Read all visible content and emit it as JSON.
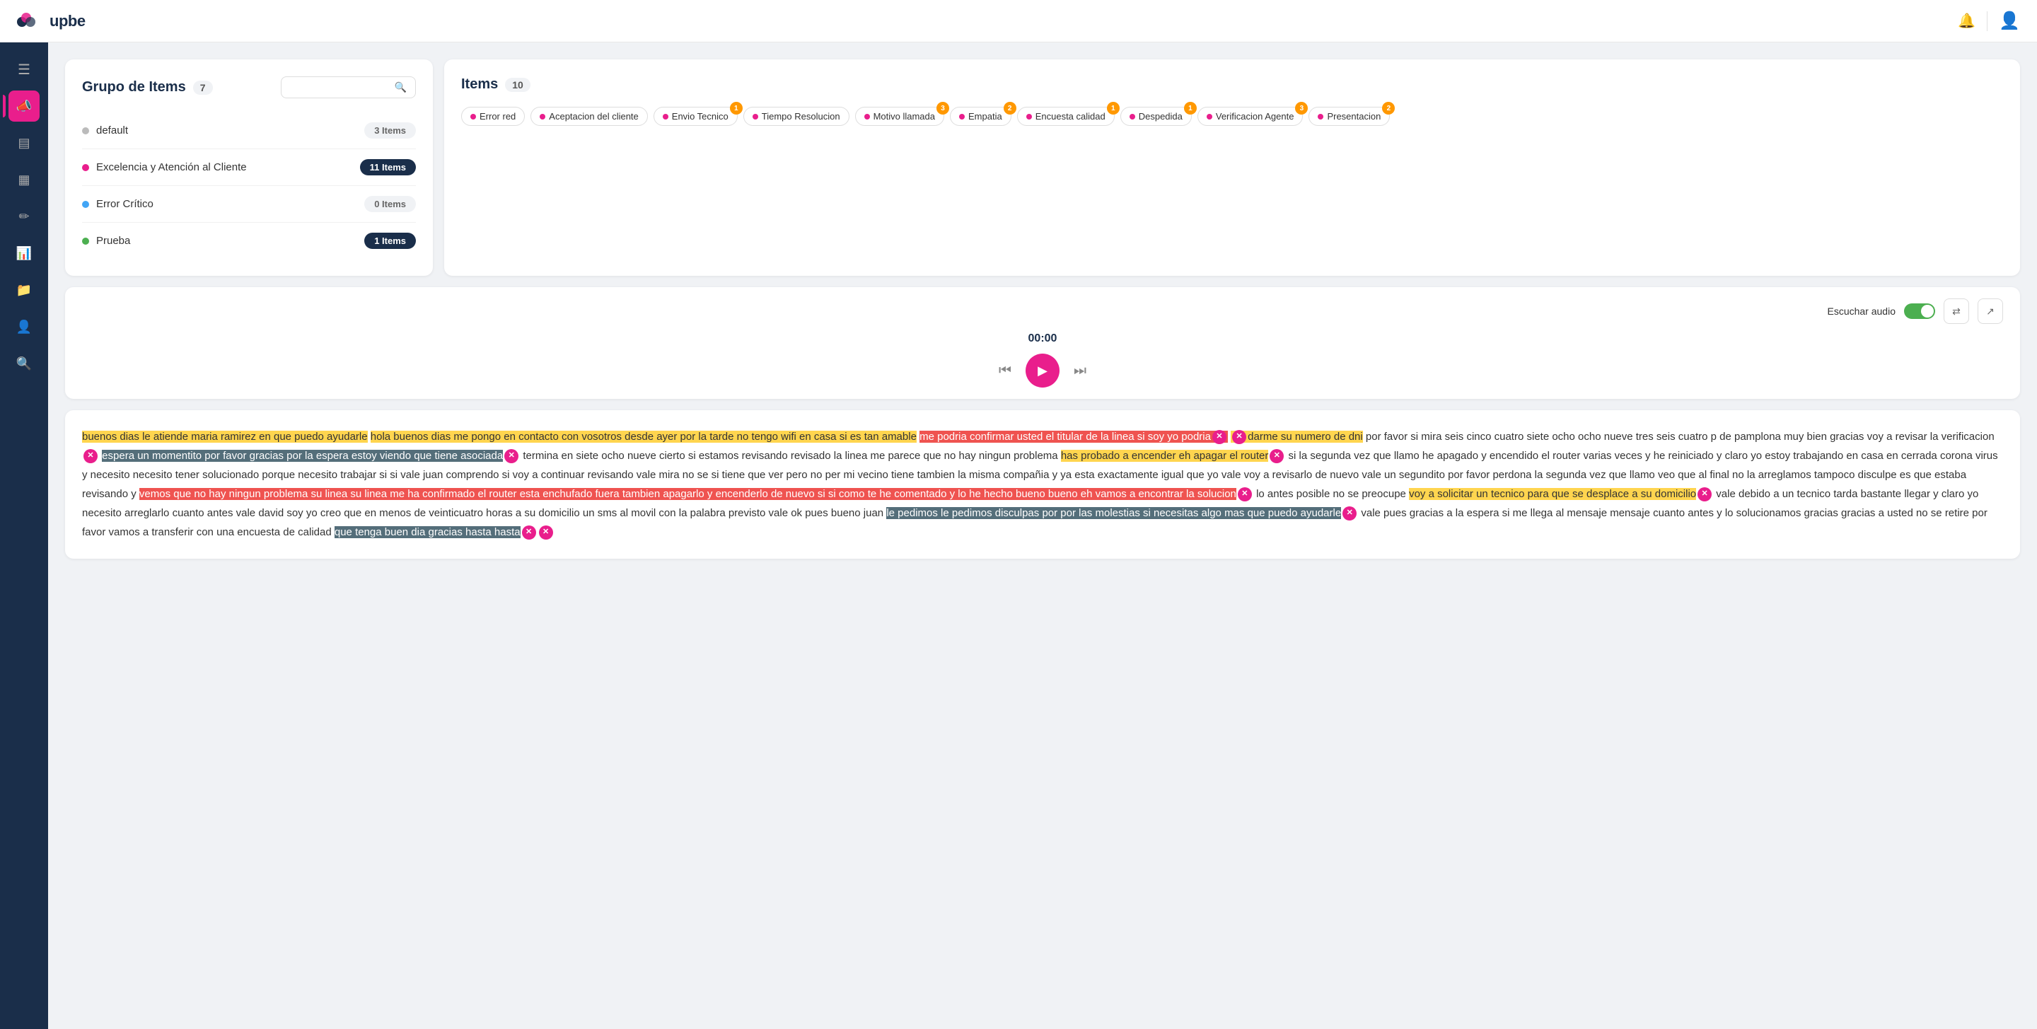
{
  "navbar": {
    "logo_text": "upbe",
    "notification_icon": "🔔",
    "user_icon": "👤"
  },
  "sidebar": {
    "items": [
      {
        "id": "menu",
        "icon": "☰",
        "active": false
      },
      {
        "id": "megaphone",
        "icon": "📣",
        "active": true
      },
      {
        "id": "list",
        "icon": "☰",
        "active": false
      },
      {
        "id": "grid",
        "icon": "▦",
        "active": false
      },
      {
        "id": "pencil",
        "icon": "✏",
        "active": false
      },
      {
        "id": "chart",
        "icon": "📊",
        "active": false
      },
      {
        "id": "folder",
        "icon": "📁",
        "active": false
      },
      {
        "id": "user",
        "icon": "👤",
        "active": false
      },
      {
        "id": "search",
        "icon": "🔍",
        "active": false
      }
    ]
  },
  "left_panel": {
    "title": "Grupo de Items",
    "count": 7,
    "search_placeholder": "",
    "items": [
      {
        "name": "default",
        "dot_color": "#bbb",
        "badge": "3 Items",
        "dark": false
      },
      {
        "name": "Excelencia y Atención al Cliente",
        "dot_color": "#e91e8c",
        "badge": "11 Items",
        "dark": true
      },
      {
        "name": "Error Crítico",
        "dot_color": "#42a5f5",
        "badge": "0 Items",
        "dark": false
      },
      {
        "name": "Prueba",
        "dot_color": "#4caf50",
        "badge": "1 Items",
        "dark": true
      }
    ]
  },
  "right_panel": {
    "title": "Items",
    "count": 10,
    "tags": [
      {
        "label": "Error red",
        "dot_color": "#e91e8c",
        "badge": null
      },
      {
        "label": "Aceptacion del cliente",
        "dot_color": "#e91e8c",
        "badge": null
      },
      {
        "label": "Envio Tecnico",
        "dot_color": "#e91e8c",
        "badge": "1",
        "badge_type": "orange"
      },
      {
        "label": "Tiempo Resolucion",
        "dot_color": "#e91e8c",
        "badge": null
      },
      {
        "label": "Motivo llamada",
        "dot_color": "#e91e8c",
        "badge": "3",
        "badge_type": "orange"
      },
      {
        "label": "Empatia",
        "dot_color": "#e91e8c",
        "badge": "2",
        "badge_type": "orange"
      },
      {
        "label": "Encuesta calidad",
        "dot_color": "#e91e8c",
        "badge": "1",
        "badge_type": "orange"
      },
      {
        "label": "Despedida",
        "dot_color": "#e91e8c",
        "badge": "1",
        "badge_type": "orange"
      },
      {
        "label": "Verificacion Agente",
        "dot_color": "#e91e8c",
        "badge": "3",
        "badge_type": "orange"
      },
      {
        "label": "Presentacion",
        "dot_color": "#e91e8c",
        "badge": "2",
        "badge_type": "orange"
      }
    ]
  },
  "audio_player": {
    "escuchar_audio_label": "Escuchar audio",
    "timestamp": "00:00"
  },
  "transcript": {
    "text": "buenos dias le atiende maria ramirez en que puedo ayudarle hola buenos dias me pongo en contacto con vosotros desde ayer por la tarde no tengo wifi en casa si es tan amable me podria confirmar usted el titular de la linea si soy yo podria darme su numero de dni por favor si mira seis cinco cuatro siete ocho ocho nueve tres seis cuatro p de pamplona muy bien gracias voy a revisar la verificacion espera un momentito por favor gracias por la espera estoy viendo que tiene asociada termina en siete ocho nueve cierto si estamos revisando revisado la linea me parece que no hay ningun problema has probado a encender eh apagar el router si la segunda vez que llamo he apagado y encendido el router varias veces y he reiniciado y claro yo estoy trabajando en casa en cerrada corona virus y necesito necesito tener solucionado porque necesito trabajar si si vale juan comprendo si voy a continuar revisando vale mira no se si tiene que ver pero no per mi vecino tiene tambien la misma compañia y ya esta exactamente igual que yo vale voy a revisarlo de nuevo vale un segundito por favor perdona la segunda vez que llamo veo que al final no la arreglamos tampoco disculpe es que estaba revisando y vemos que no hay ningun problema su linea su linea me ha confirmado el router esta enchufado fuera tambien apagarlo y encenderlo de nuevo si si como te he comentado y lo he hecho bueno bueno eh vamos a encontrar la solucion lo antes posible no se preocupe voy a solicitar un tecnico para que se desplace a su domicilio vale debido a un tecnico tarda bastante llegar y claro yo necesito arreglarlo cuanto antes vale david soy yo creo que en menos de veinticuatro horas a su domicilio un sms al movil con la palabra previsto vale ok pues bueno juan le pedimos le pedimos disculpas por por las molestias si necesitas algo mas que puedo ayudarle vale pues gracias a la espera si me llega al mensaje mensaje cuanto antes y lo solucionamos gracias gracias a usted no se retire por favor vamos a transferir con una encuesta de calidad que tenga buen dia gracias hasta hasta"
  }
}
